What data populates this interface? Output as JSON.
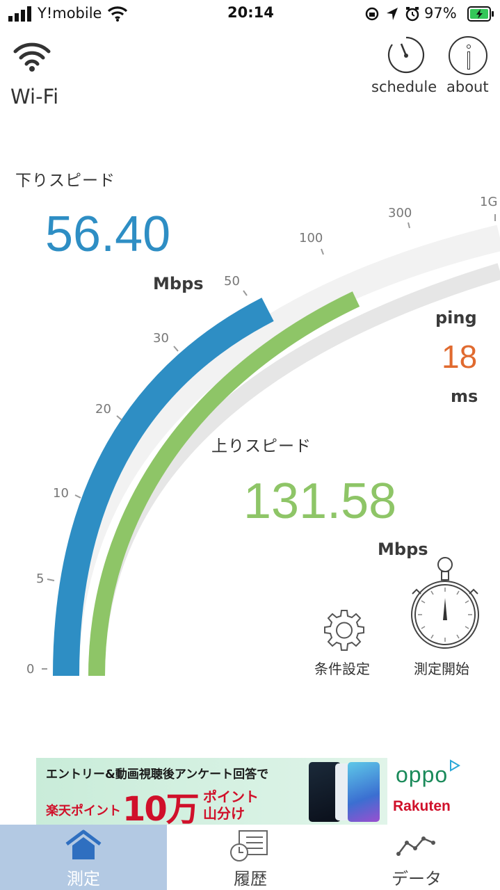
{
  "status_bar": {
    "carrier": "Y!mobile",
    "time": "20:14",
    "battery": "97%"
  },
  "header": {
    "connection_label": "Wi-Fi",
    "schedule_label": "schedule",
    "about_label": "about"
  },
  "download": {
    "label": "下りスピード",
    "value": "56.40",
    "unit": "Mbps",
    "color": "#2e8ec4"
  },
  "upload": {
    "label": "上りスピード",
    "value": "131.58",
    "unit": "Mbps",
    "color": "#8ec567"
  },
  "ping": {
    "label": "ping",
    "value": "18",
    "unit": "ms",
    "color": "#e06a2f"
  },
  "gauge": {
    "ticks": [
      "0",
      "5",
      "10",
      "20",
      "30",
      "50",
      "100",
      "300",
      "1G"
    ]
  },
  "actions": {
    "settings_label": "条件設定",
    "start_label": "測定開始"
  },
  "ad": {
    "line1": "エントリー&動画視聴後アンケート回答で",
    "brand_points": "楽天ポイント",
    "amount": "10万",
    "points_line1": "ポイント",
    "points_line2": "山分け",
    "logo_top": "oppo",
    "logo_bottom": "Rakuten"
  },
  "nav": {
    "items": [
      {
        "label": "測定"
      },
      {
        "label": "履歴"
      },
      {
        "label": "データ"
      }
    ]
  }
}
